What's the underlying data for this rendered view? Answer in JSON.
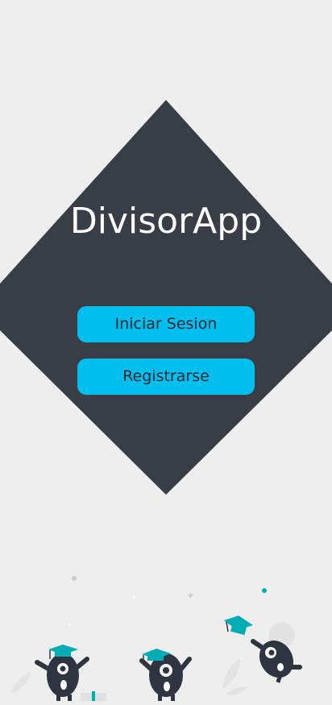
{
  "app": {
    "title": "DivisorApp"
  },
  "actions": {
    "login_label": "Iniciar Sesion",
    "register_label": "Registrarse"
  },
  "colors": {
    "background": "#eeeeee",
    "diamond": "#393e46",
    "button": "#00bfef",
    "button_text": "#1f2630",
    "accent": "#00adb5"
  },
  "illustration": {
    "icon": "graduation-monsters-illustration"
  }
}
